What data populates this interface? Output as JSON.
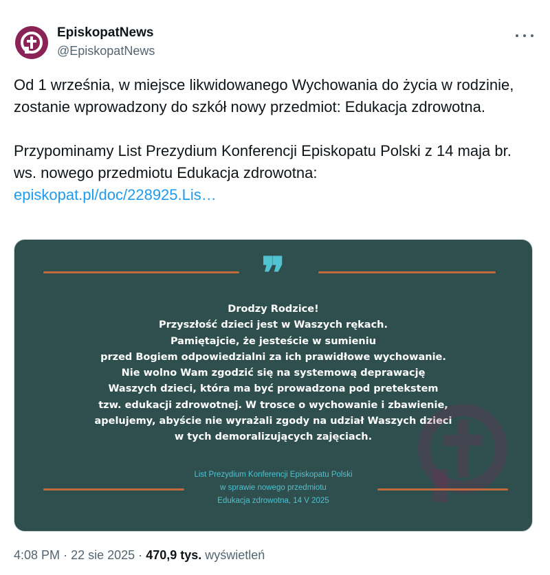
{
  "author": {
    "name": "EpiskopatNews",
    "handle": "@EpiskopatNews",
    "avatar_color": "#8a2456",
    "avatar_icon": "cross-in-circle-logo"
  },
  "more_menu": {
    "icon": "more-horizontal-icon"
  },
  "tweet": {
    "paragraph1": "Od 1 września, w miejsce likwidowanego Wychowania do życia w rodzinie, zostanie wprowadzony do szkół nowy przedmiot: Edukacja zdrowotna.",
    "paragraph2": "Przypominamy List Prezydium Konferencji Episkopatu Polski z 14 maja br. ws. nowego przedmiotu Edukacja zdrowotna:",
    "link_text": "episkopat.pl/doc/228925.Lis…"
  },
  "media": {
    "background_color": "#2f4f4f",
    "accent_color": "#4fc3d0",
    "rule_color": "#c26a3c",
    "quote_mark": "❞",
    "letter_lines": [
      "Drodzy Rodzice!",
      "Przyszłość dzieci jest w Waszych rękach.",
      "Pamiętajcie, że jesteście w sumieniu",
      "przed Bogiem odpowiedzialni za ich prawidłowe wychowanie.",
      "Nie wolno Wam zgodzić się na systemową deprawację",
      "Waszych dzieci, która ma być prowadzona pod pretekstem",
      "tzw. edukacji zdrowotnej. W trosce o wychowanie i zbawienie,",
      "apelujemy, abyście nie wyrażali zgody na udział Waszych dzieci",
      "w tych demoralizujących zajęciach."
    ],
    "caption_lines": [
      "List Prezydium Konferencji Episkopatu Polski",
      "w sprawie nowego przedmiotu",
      "Edukacja zdrowotna, 14 V 2025"
    ]
  },
  "meta": {
    "time": "4:08 PM",
    "separator": "·",
    "date": "22 sie 2025",
    "views_count": "470,9 tys.",
    "views_label": "wyświetleń"
  }
}
